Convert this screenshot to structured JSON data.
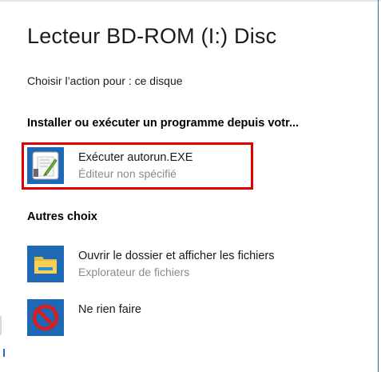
{
  "dialog": {
    "title": "Lecteur BD-ROM (I:) Disc",
    "subtitle": "Choisir l’action pour : ce disque"
  },
  "sections": {
    "install": {
      "title": "Installer ou exécuter un programme depuis votr..."
    },
    "other": {
      "title": "Autres choix"
    }
  },
  "options": [
    {
      "label": "Exécuter autorun.EXE",
      "sublabel": "Éditeur non spécifié",
      "icon": "autorun-exe-icon"
    },
    {
      "label": "Ouvrir le dossier et afficher les fichiers",
      "sublabel": "Explorateur de fichiers",
      "icon": "folder-icon"
    },
    {
      "label": "Ne rien faire",
      "icon": "no-action-icon"
    }
  ],
  "colors": {
    "highlight": "#e00000",
    "icon_tile_blue": "#1e68b5",
    "sublabel_gray": "#8a8a8a"
  }
}
